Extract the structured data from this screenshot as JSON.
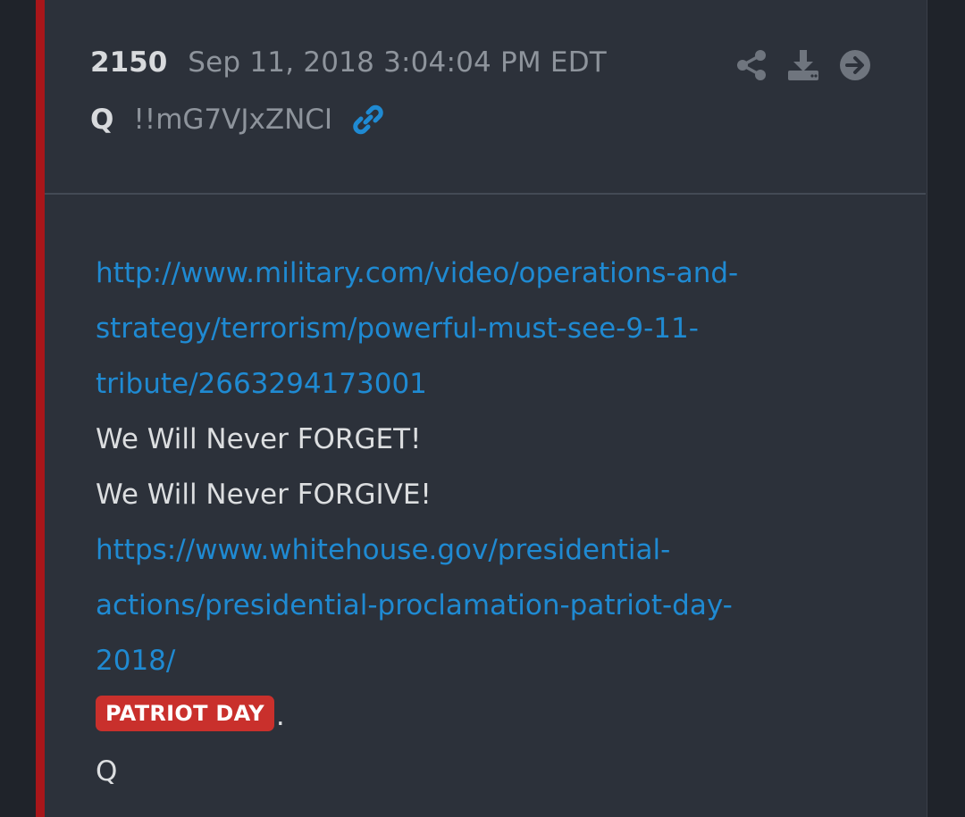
{
  "post": {
    "number": "2150",
    "date": "Sep 11, 2018 3:04:04 PM EDT",
    "author": "Q",
    "tripcode": "!!mG7VJxZNCI",
    "icons": {
      "share": "share-icon",
      "download": "download-icon",
      "open": "arrow-circle-right-icon",
      "permalink": "link-icon"
    },
    "colors": {
      "accent_bar": "#a8161a",
      "link": "#1f8ad2",
      "tag_bg": "#c9302c",
      "card_bg": "#2c313a",
      "page_bg": "#1f232a"
    },
    "body": {
      "link1_lines": [
        "http://www.military.com/video/operations-and-",
        "strategy/terrorism/powerful-must-see-9-11-",
        "tribute/2663294173001"
      ],
      "text1": "We Will Never FORGET!",
      "text2": "We Will Never FORGIVE!",
      "link2_lines": [
        "https://www.whitehouse.gov/presidential-",
        "actions/presidential-proclamation-patriot-day-",
        "2018/"
      ],
      "tag": "PATRIOT DAY",
      "tag_suffix": ".",
      "signature": "Q"
    }
  }
}
